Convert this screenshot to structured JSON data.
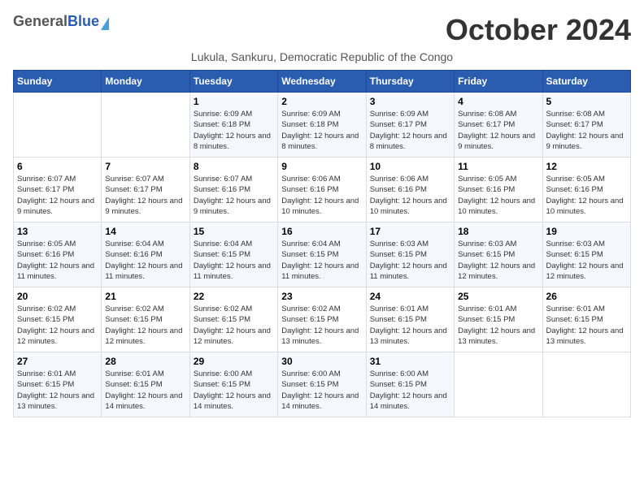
{
  "header": {
    "logo": {
      "general": "General",
      "blue": "Blue"
    },
    "title": "October 2024",
    "subtitle": "Lukula, Sankuru, Democratic Republic of the Congo"
  },
  "weekdays": [
    "Sunday",
    "Monday",
    "Tuesday",
    "Wednesday",
    "Thursday",
    "Friday",
    "Saturday"
  ],
  "weeks": [
    [
      {
        "day": "",
        "info": ""
      },
      {
        "day": "",
        "info": ""
      },
      {
        "day": "1",
        "info": "Sunrise: 6:09 AM\nSunset: 6:18 PM\nDaylight: 12 hours and 8 minutes."
      },
      {
        "day": "2",
        "info": "Sunrise: 6:09 AM\nSunset: 6:18 PM\nDaylight: 12 hours and 8 minutes."
      },
      {
        "day": "3",
        "info": "Sunrise: 6:09 AM\nSunset: 6:17 PM\nDaylight: 12 hours and 8 minutes."
      },
      {
        "day": "4",
        "info": "Sunrise: 6:08 AM\nSunset: 6:17 PM\nDaylight: 12 hours and 9 minutes."
      },
      {
        "day": "5",
        "info": "Sunrise: 6:08 AM\nSunset: 6:17 PM\nDaylight: 12 hours and 9 minutes."
      }
    ],
    [
      {
        "day": "6",
        "info": "Sunrise: 6:07 AM\nSunset: 6:17 PM\nDaylight: 12 hours and 9 minutes."
      },
      {
        "day": "7",
        "info": "Sunrise: 6:07 AM\nSunset: 6:17 PM\nDaylight: 12 hours and 9 minutes."
      },
      {
        "day": "8",
        "info": "Sunrise: 6:07 AM\nSunset: 6:16 PM\nDaylight: 12 hours and 9 minutes."
      },
      {
        "day": "9",
        "info": "Sunrise: 6:06 AM\nSunset: 6:16 PM\nDaylight: 12 hours and 10 minutes."
      },
      {
        "day": "10",
        "info": "Sunrise: 6:06 AM\nSunset: 6:16 PM\nDaylight: 12 hours and 10 minutes."
      },
      {
        "day": "11",
        "info": "Sunrise: 6:05 AM\nSunset: 6:16 PM\nDaylight: 12 hours and 10 minutes."
      },
      {
        "day": "12",
        "info": "Sunrise: 6:05 AM\nSunset: 6:16 PM\nDaylight: 12 hours and 10 minutes."
      }
    ],
    [
      {
        "day": "13",
        "info": "Sunrise: 6:05 AM\nSunset: 6:16 PM\nDaylight: 12 hours and 11 minutes."
      },
      {
        "day": "14",
        "info": "Sunrise: 6:04 AM\nSunset: 6:16 PM\nDaylight: 12 hours and 11 minutes."
      },
      {
        "day": "15",
        "info": "Sunrise: 6:04 AM\nSunset: 6:15 PM\nDaylight: 12 hours and 11 minutes."
      },
      {
        "day": "16",
        "info": "Sunrise: 6:04 AM\nSunset: 6:15 PM\nDaylight: 12 hours and 11 minutes."
      },
      {
        "day": "17",
        "info": "Sunrise: 6:03 AM\nSunset: 6:15 PM\nDaylight: 12 hours and 11 minutes."
      },
      {
        "day": "18",
        "info": "Sunrise: 6:03 AM\nSunset: 6:15 PM\nDaylight: 12 hours and 12 minutes."
      },
      {
        "day": "19",
        "info": "Sunrise: 6:03 AM\nSunset: 6:15 PM\nDaylight: 12 hours and 12 minutes."
      }
    ],
    [
      {
        "day": "20",
        "info": "Sunrise: 6:02 AM\nSunset: 6:15 PM\nDaylight: 12 hours and 12 minutes."
      },
      {
        "day": "21",
        "info": "Sunrise: 6:02 AM\nSunset: 6:15 PM\nDaylight: 12 hours and 12 minutes."
      },
      {
        "day": "22",
        "info": "Sunrise: 6:02 AM\nSunset: 6:15 PM\nDaylight: 12 hours and 12 minutes."
      },
      {
        "day": "23",
        "info": "Sunrise: 6:02 AM\nSunset: 6:15 PM\nDaylight: 12 hours and 13 minutes."
      },
      {
        "day": "24",
        "info": "Sunrise: 6:01 AM\nSunset: 6:15 PM\nDaylight: 12 hours and 13 minutes."
      },
      {
        "day": "25",
        "info": "Sunrise: 6:01 AM\nSunset: 6:15 PM\nDaylight: 12 hours and 13 minutes."
      },
      {
        "day": "26",
        "info": "Sunrise: 6:01 AM\nSunset: 6:15 PM\nDaylight: 12 hours and 13 minutes."
      }
    ],
    [
      {
        "day": "27",
        "info": "Sunrise: 6:01 AM\nSunset: 6:15 PM\nDaylight: 12 hours and 13 minutes."
      },
      {
        "day": "28",
        "info": "Sunrise: 6:01 AM\nSunset: 6:15 PM\nDaylight: 12 hours and 14 minutes."
      },
      {
        "day": "29",
        "info": "Sunrise: 6:00 AM\nSunset: 6:15 PM\nDaylight: 12 hours and 14 minutes."
      },
      {
        "day": "30",
        "info": "Sunrise: 6:00 AM\nSunset: 6:15 PM\nDaylight: 12 hours and 14 minutes."
      },
      {
        "day": "31",
        "info": "Sunrise: 6:00 AM\nSunset: 6:15 PM\nDaylight: 12 hours and 14 minutes."
      },
      {
        "day": "",
        "info": ""
      },
      {
        "day": "",
        "info": ""
      }
    ]
  ]
}
